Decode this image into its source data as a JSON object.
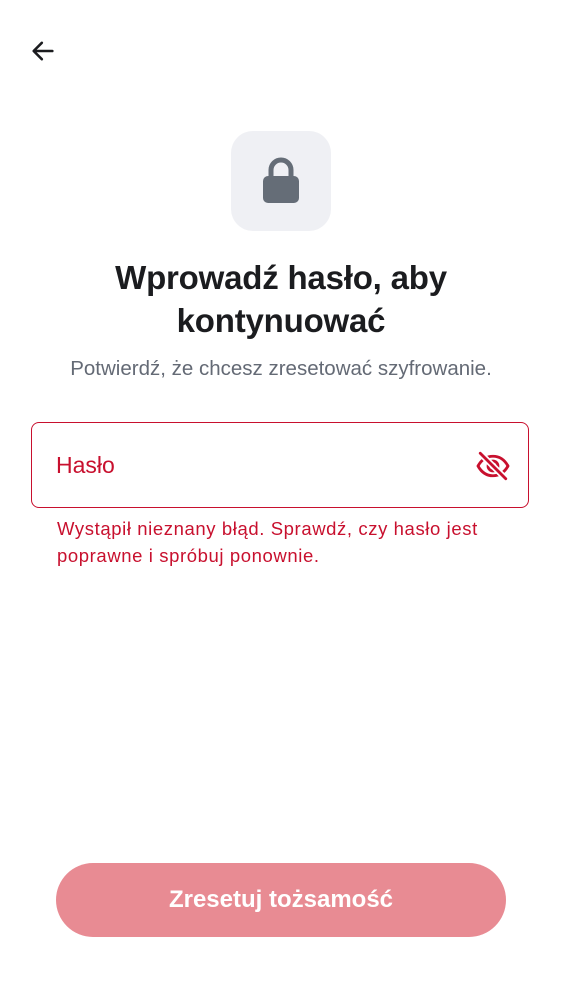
{
  "header": {
    "back_icon": "arrow-left-icon"
  },
  "hero": {
    "icon": "lock-icon",
    "title": "Wprowadź hasło, aby kontynuować",
    "subtitle": "Potwierdź, że chcesz zresetować szyfrowanie."
  },
  "password_field": {
    "label": "Hasło",
    "value": "",
    "visibility_icon": "eye-off-icon",
    "error": "Wystąpił nieznany błąd. Sprawdź, czy hasło jest poprawne i spróbuj ponownie."
  },
  "actions": {
    "reset_label": "Zresetuj tożsamość"
  },
  "colors": {
    "error": "#c8102e",
    "button_disabled_bg": "#e88b93",
    "icon_tile_bg": "#eff0f4",
    "icon_fg": "#656d77",
    "text_primary": "#1b1c1f",
    "text_secondary": "#646a75"
  }
}
